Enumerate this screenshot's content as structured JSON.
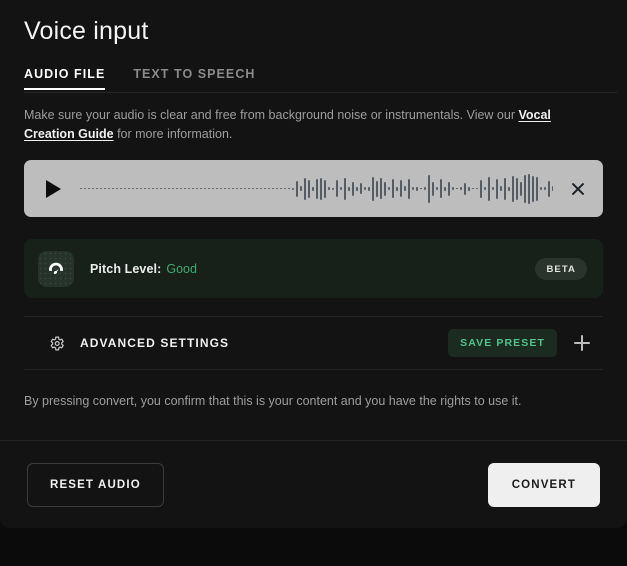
{
  "header": {
    "title": "Voice input",
    "tabs": [
      {
        "label": "AUDIO FILE",
        "active": true
      },
      {
        "label": "TEXT TO SPEECH",
        "active": false
      }
    ]
  },
  "hint": {
    "lead": "Make sure your audio is clear and free from background noise or instrumentals. View our ",
    "link": "Vocal Creation Guide",
    "tail": " for more information."
  },
  "player": {
    "play_icon": "play-icon",
    "close_icon": "close-icon",
    "waveform": [
      1,
      1,
      1,
      1,
      1,
      1,
      1,
      1,
      1,
      1,
      1,
      1,
      1,
      1,
      1,
      1,
      1,
      1,
      1,
      1,
      1,
      1,
      1,
      1,
      1,
      1,
      1,
      1,
      1,
      1,
      1,
      1,
      1,
      1,
      1,
      1,
      1,
      1,
      1,
      1,
      1,
      1,
      1,
      1,
      1,
      1,
      1,
      1,
      1,
      1,
      1,
      1,
      1,
      2,
      16,
      5,
      22,
      18,
      4,
      20,
      22,
      18,
      3,
      2,
      17,
      3,
      22,
      4,
      14,
      4,
      11,
      3,
      4,
      24,
      16,
      21,
      14,
      3,
      19,
      4,
      17,
      5,
      20,
      3,
      4,
      1,
      3,
      28,
      14,
      3,
      19,
      4,
      14,
      3,
      1,
      3,
      12,
      4,
      1,
      1,
      18,
      3,
      24,
      3,
      20,
      5,
      22,
      4,
      26,
      22,
      14,
      28,
      30,
      26,
      24,
      3,
      3,
      16,
      5,
      19,
      4,
      20,
      4,
      13,
      3,
      1,
      3,
      19,
      4,
      3,
      3,
      3,
      3,
      1,
      1,
      14,
      3,
      15,
      3,
      1,
      3,
      2,
      2,
      2,
      14,
      1,
      1,
      1,
      1,
      1,
      1,
      1,
      1,
      1,
      1,
      1,
      1,
      1,
      1,
      1,
      1,
      1,
      1,
      1,
      1,
      1,
      1,
      1,
      1,
      1,
      1,
      1,
      1,
      1,
      1,
      1,
      1,
      1,
      1
    ]
  },
  "pitch": {
    "icon": "gauge-icon",
    "label": "Pitch Level:",
    "value": "Good",
    "value_color": "#3fab74",
    "badge": "BETA"
  },
  "advanced": {
    "icon": "gear-icon",
    "label": "ADVANCED SETTINGS",
    "save_preset": "SAVE PRESET",
    "add_icon": "plus-icon"
  },
  "disclaimer": "By pressing convert, you confirm that this is your content and you have the rights to use it.",
  "footer": {
    "reset": "RESET AUDIO",
    "convert": "CONVERT"
  }
}
